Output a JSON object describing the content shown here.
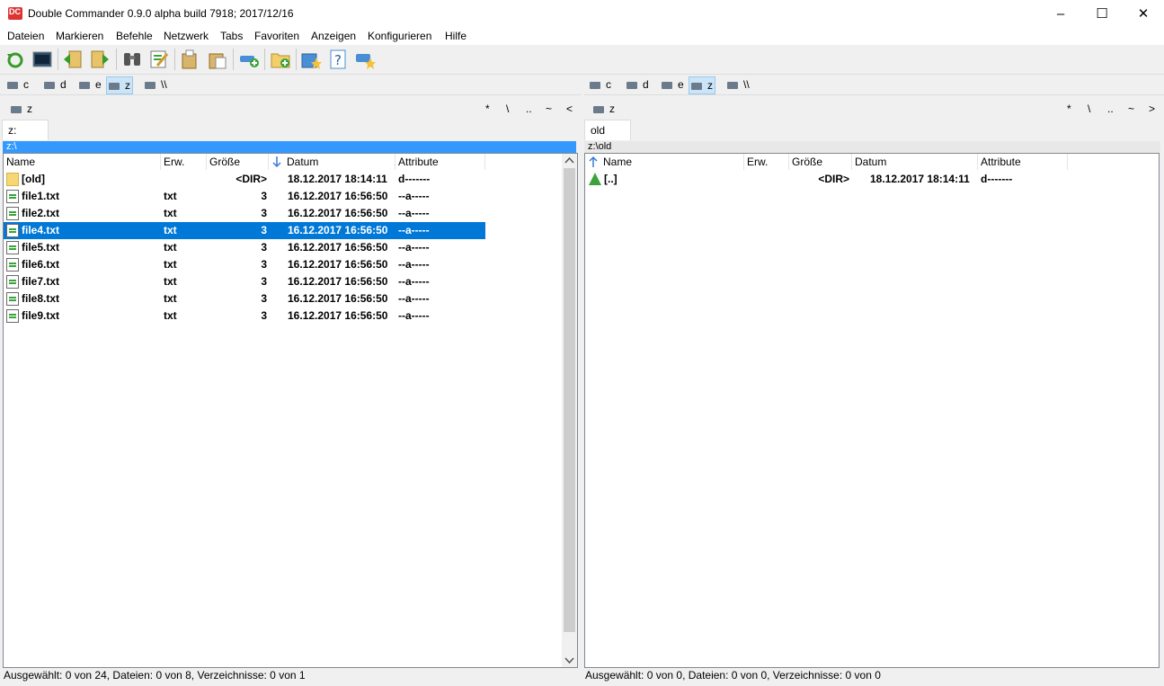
{
  "window": {
    "title": "Double Commander 0.9.0 alpha build 7918; 2017/12/16",
    "minimize": "–",
    "maximize": "☐",
    "close": "✕"
  },
  "menu": [
    "Dateien",
    "Markieren",
    "Befehle",
    "Netzwerk",
    "Tabs",
    "Favoriten",
    "Anzeigen",
    "Konfigurieren",
    "Hilfe"
  ],
  "toolbar_icons": [
    "refresh-icon",
    "terminal-icon",
    "copy-left-icon",
    "copy-right-icon",
    "search-icon",
    "edit-icon",
    "copy-icon",
    "paste-icon",
    "network-connect-icon",
    "new-folder-icon",
    "favorites-icon",
    "help-icon",
    "hotlist-icon"
  ],
  "drives": [
    "c",
    "d",
    "e",
    "z",
    "\\\\"
  ],
  "left": {
    "active_drive": "z",
    "current_drive": "z",
    "nav": [
      "*",
      "\\",
      "..",
      "~",
      "<"
    ],
    "tab": "z:",
    "path": "z:\\",
    "columns": [
      "Name",
      "Erw.",
      "Größe",
      "Datum",
      "Attribute"
    ],
    "rows": [
      {
        "name": "[old]",
        "ext": "",
        "size": "<DIR>",
        "date": "18.12.2017 18:14:11",
        "attr": "d-------",
        "icon": "folder"
      },
      {
        "name": "file1.txt",
        "ext": "txt",
        "size": "3",
        "date": "16.12.2017 16:56:50",
        "attr": "--a-----",
        "icon": "file"
      },
      {
        "name": "file2.txt",
        "ext": "txt",
        "size": "3",
        "date": "16.12.2017 16:56:50",
        "attr": "--a-----",
        "icon": "file"
      },
      {
        "name": "file4.txt",
        "ext": "txt",
        "size": "3",
        "date": "16.12.2017 16:56:50",
        "attr": "--a-----",
        "icon": "file",
        "selected": true
      },
      {
        "name": "file5.txt",
        "ext": "txt",
        "size": "3",
        "date": "16.12.2017 16:56:50",
        "attr": "--a-----",
        "icon": "file"
      },
      {
        "name": "file6.txt",
        "ext": "txt",
        "size": "3",
        "date": "16.12.2017 16:56:50",
        "attr": "--a-----",
        "icon": "file"
      },
      {
        "name": "file7.txt",
        "ext": "txt",
        "size": "3",
        "date": "16.12.2017 16:56:50",
        "attr": "--a-----",
        "icon": "file"
      },
      {
        "name": "file8.txt",
        "ext": "txt",
        "size": "3",
        "date": "16.12.2017 16:56:50",
        "attr": "--a-----",
        "icon": "file"
      },
      {
        "name": "file9.txt",
        "ext": "txt",
        "size": "3",
        "date": "16.12.2017 16:56:50",
        "attr": "--a-----",
        "icon": "file"
      }
    ],
    "status": "Ausgewählt: 0 von 24, Dateien: 0 von 8, Verzeichnisse: 0 von 1"
  },
  "right": {
    "active_drive": "z",
    "current_drive": "z",
    "nav": [
      "*",
      "\\",
      "..",
      "~",
      ">"
    ],
    "tab": "old",
    "path": "z:\\old",
    "columns": [
      "Name",
      "Erw.",
      "Größe",
      "Datum",
      "Attribute"
    ],
    "rows": [
      {
        "name": "[..]",
        "ext": "",
        "size": "<DIR>",
        "date": "18.12.2017 18:14:11",
        "attr": "d-------",
        "icon": "up"
      }
    ],
    "status": "Ausgewählt: 0 von 0, Dateien: 0 von 0, Verzeichnisse: 0 von 0"
  },
  "colors": {
    "selection": "#0078d7",
    "path_active": "#3399ff"
  }
}
